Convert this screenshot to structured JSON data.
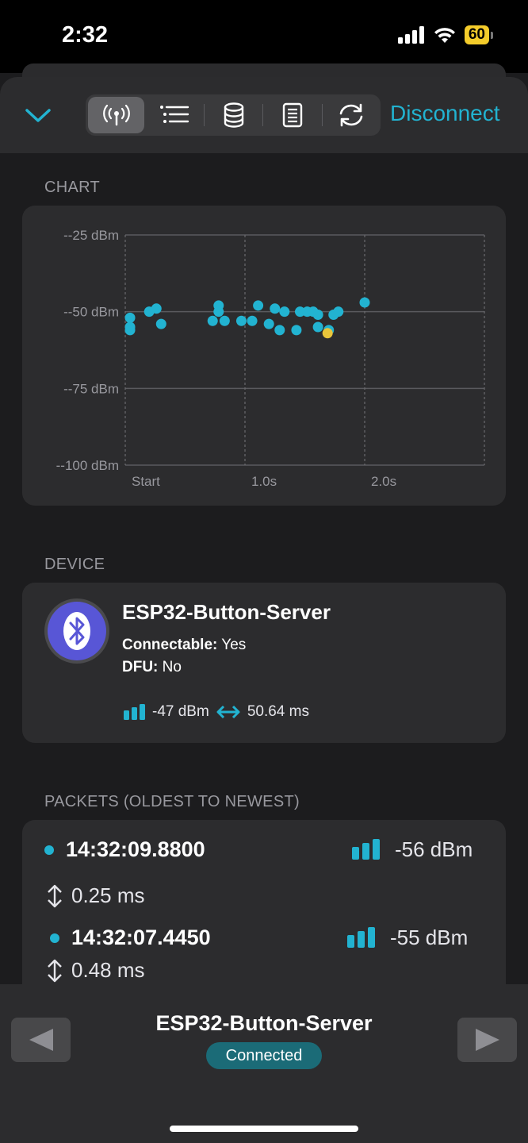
{
  "status_bar": {
    "time": "2:32",
    "battery": "60"
  },
  "toolbar": {
    "tabs": [
      {
        "icon": "antenna-icon",
        "selected": true
      },
      {
        "icon": "list-icon"
      },
      {
        "icon": "database-icon"
      },
      {
        "icon": "document-icon"
      },
      {
        "icon": "refresh-icon"
      }
    ],
    "disconnect_label": "Disconnect"
  },
  "chart_section": {
    "label": "CHART"
  },
  "chart_data": {
    "type": "scatter",
    "x_ticks": [
      "Start",
      "1.0s",
      "2.0s"
    ],
    "y_ticks": [
      "--25 dBm",
      "--50 dBm",
      "--75 dBm",
      "--100 dBm"
    ],
    "ylim": [
      -100,
      -25
    ],
    "xlim": [
      0,
      3.0
    ],
    "grid": true,
    "series": [
      {
        "color": "#22b3d1",
        "points": [
          [
            0.04,
            -52
          ],
          [
            0.04,
            -55
          ],
          [
            0.04,
            -56
          ],
          [
            0.2,
            -50
          ],
          [
            0.26,
            -49
          ],
          [
            0.3,
            -54
          ],
          [
            0.73,
            -53
          ],
          [
            0.78,
            -48
          ],
          [
            0.78,
            -50
          ],
          [
            0.83,
            -53
          ],
          [
            0.97,
            -53
          ],
          [
            1.06,
            -53
          ],
          [
            1.11,
            -48
          ],
          [
            1.2,
            -54
          ],
          [
            1.25,
            -49
          ],
          [
            1.29,
            -56
          ],
          [
            1.33,
            -50
          ],
          [
            1.43,
            -56
          ],
          [
            1.46,
            -50
          ],
          [
            1.52,
            -50
          ],
          [
            1.57,
            -50
          ],
          [
            1.61,
            -51
          ],
          [
            1.61,
            -55
          ],
          [
            1.7,
            -56
          ],
          [
            1.74,
            -51
          ],
          [
            1.78,
            -50
          ],
          [
            2.0,
            -47
          ]
        ]
      },
      {
        "color": "#e9c53a",
        "points": [
          [
            1.69,
            -57
          ]
        ]
      }
    ]
  },
  "device_section": {
    "label": "DEVICE",
    "name": "ESP32-Button-Server",
    "connectable_key": "Connectable:",
    "connectable_val": "Yes",
    "dfu_key": "DFU:",
    "dfu_val": "No",
    "rssi": "-47 dBm",
    "interval": "50.64 ms"
  },
  "packets_section": {
    "label": "PACKETS (OLDEST TO NEWEST)",
    "items": [
      {
        "time": "14:32:09.8800",
        "rssi": "-56 dBm",
        "delta": "0.25 ms"
      },
      {
        "time": "14:32:07.4450",
        "rssi": "-55 dBm",
        "delta": "0.48 ms"
      }
    ]
  },
  "bottom_bar": {
    "title": "ESP32-Button-Server",
    "status": "Connected"
  }
}
